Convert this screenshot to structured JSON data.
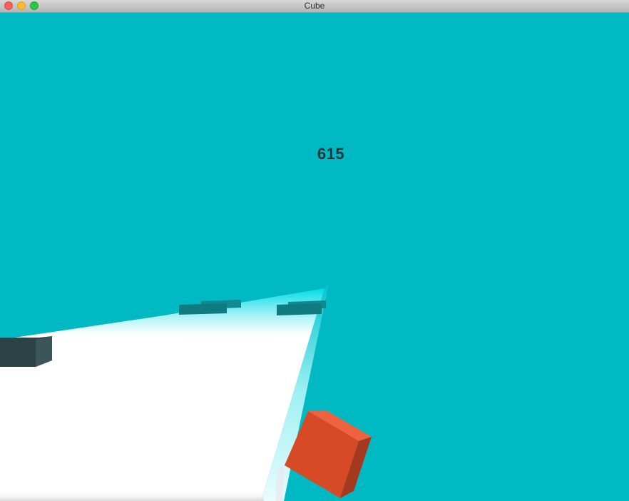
{
  "window": {
    "title": "Cube"
  },
  "game": {
    "score": "615"
  },
  "colors": {
    "sky": "#01b9c2",
    "track": "#ffffff",
    "track_glow": "#c6f7fb",
    "obstacle_near": "#2d4246",
    "obstacle_far": "#117a80",
    "player_cube_front": "#d64a26",
    "player_cube_top": "#f0623f",
    "player_cube_side": "#a5391f",
    "score_text": "#1d3438"
  },
  "icons": [
    "close-button-icon",
    "minimize-button-icon",
    "maximize-button-icon"
  ]
}
